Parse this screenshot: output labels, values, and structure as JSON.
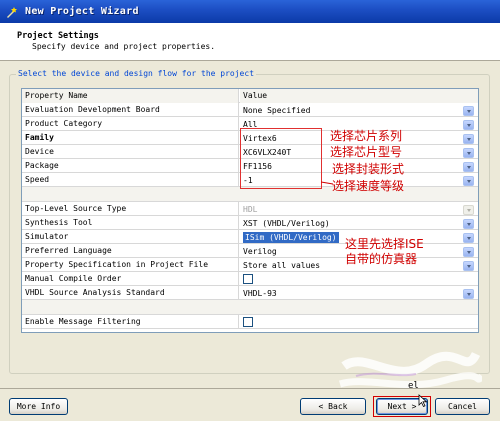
{
  "window": {
    "title": "New Project Wizard"
  },
  "header": {
    "title": "Project Settings",
    "subtitle": "Specify device and project properties."
  },
  "group": {
    "legend": "Select the device and design flow for the project"
  },
  "table": {
    "col_property": "Property Name",
    "col_value": "Value",
    "rows": [
      {
        "label": "Evaluation Development Board",
        "value": "None Specified"
      },
      {
        "label": "Product Category",
        "value": "All"
      },
      {
        "label": "Family",
        "value": "Virtex6"
      },
      {
        "label": "Device",
        "value": "XC6VLX240T"
      },
      {
        "label": "Package",
        "value": "FF1156"
      },
      {
        "label": "Speed",
        "value": "-1"
      },
      {
        "label": "Top-Level Source Type",
        "value": "HDL"
      },
      {
        "label": "Synthesis Tool",
        "value": "XST (VHDL/Verilog)"
      },
      {
        "label": "Simulator",
        "value": "ISim (VHDL/Verilog)"
      },
      {
        "label": "Preferred Language",
        "value": "Verilog"
      },
      {
        "label": "Property Specification in Project File",
        "value": "Store all values"
      },
      {
        "label": "Manual Compile Order",
        "checked": false
      },
      {
        "label": "VHDL Source Analysis Standard",
        "value": "VHDL-93"
      },
      {
        "label": "Enable Message Filtering",
        "checked": false
      }
    ]
  },
  "annotations": {
    "family": "选择芯片系列",
    "device": "选择芯片型号",
    "package": "选择封装形式",
    "speed": "选择速度等级",
    "simulator_1": "这里先选择ISE",
    "simulator_2": "自带的仿真器"
  },
  "buttons": {
    "more_info": "More Info",
    "back": "< Back",
    "next": "Next >",
    "cancel": "Cancel",
    "partial": "el"
  },
  "colors": {
    "title_bar": "#0b3aa8",
    "legend": "#0046d5",
    "annotation": "#d00000",
    "selection": "#316ac5"
  }
}
